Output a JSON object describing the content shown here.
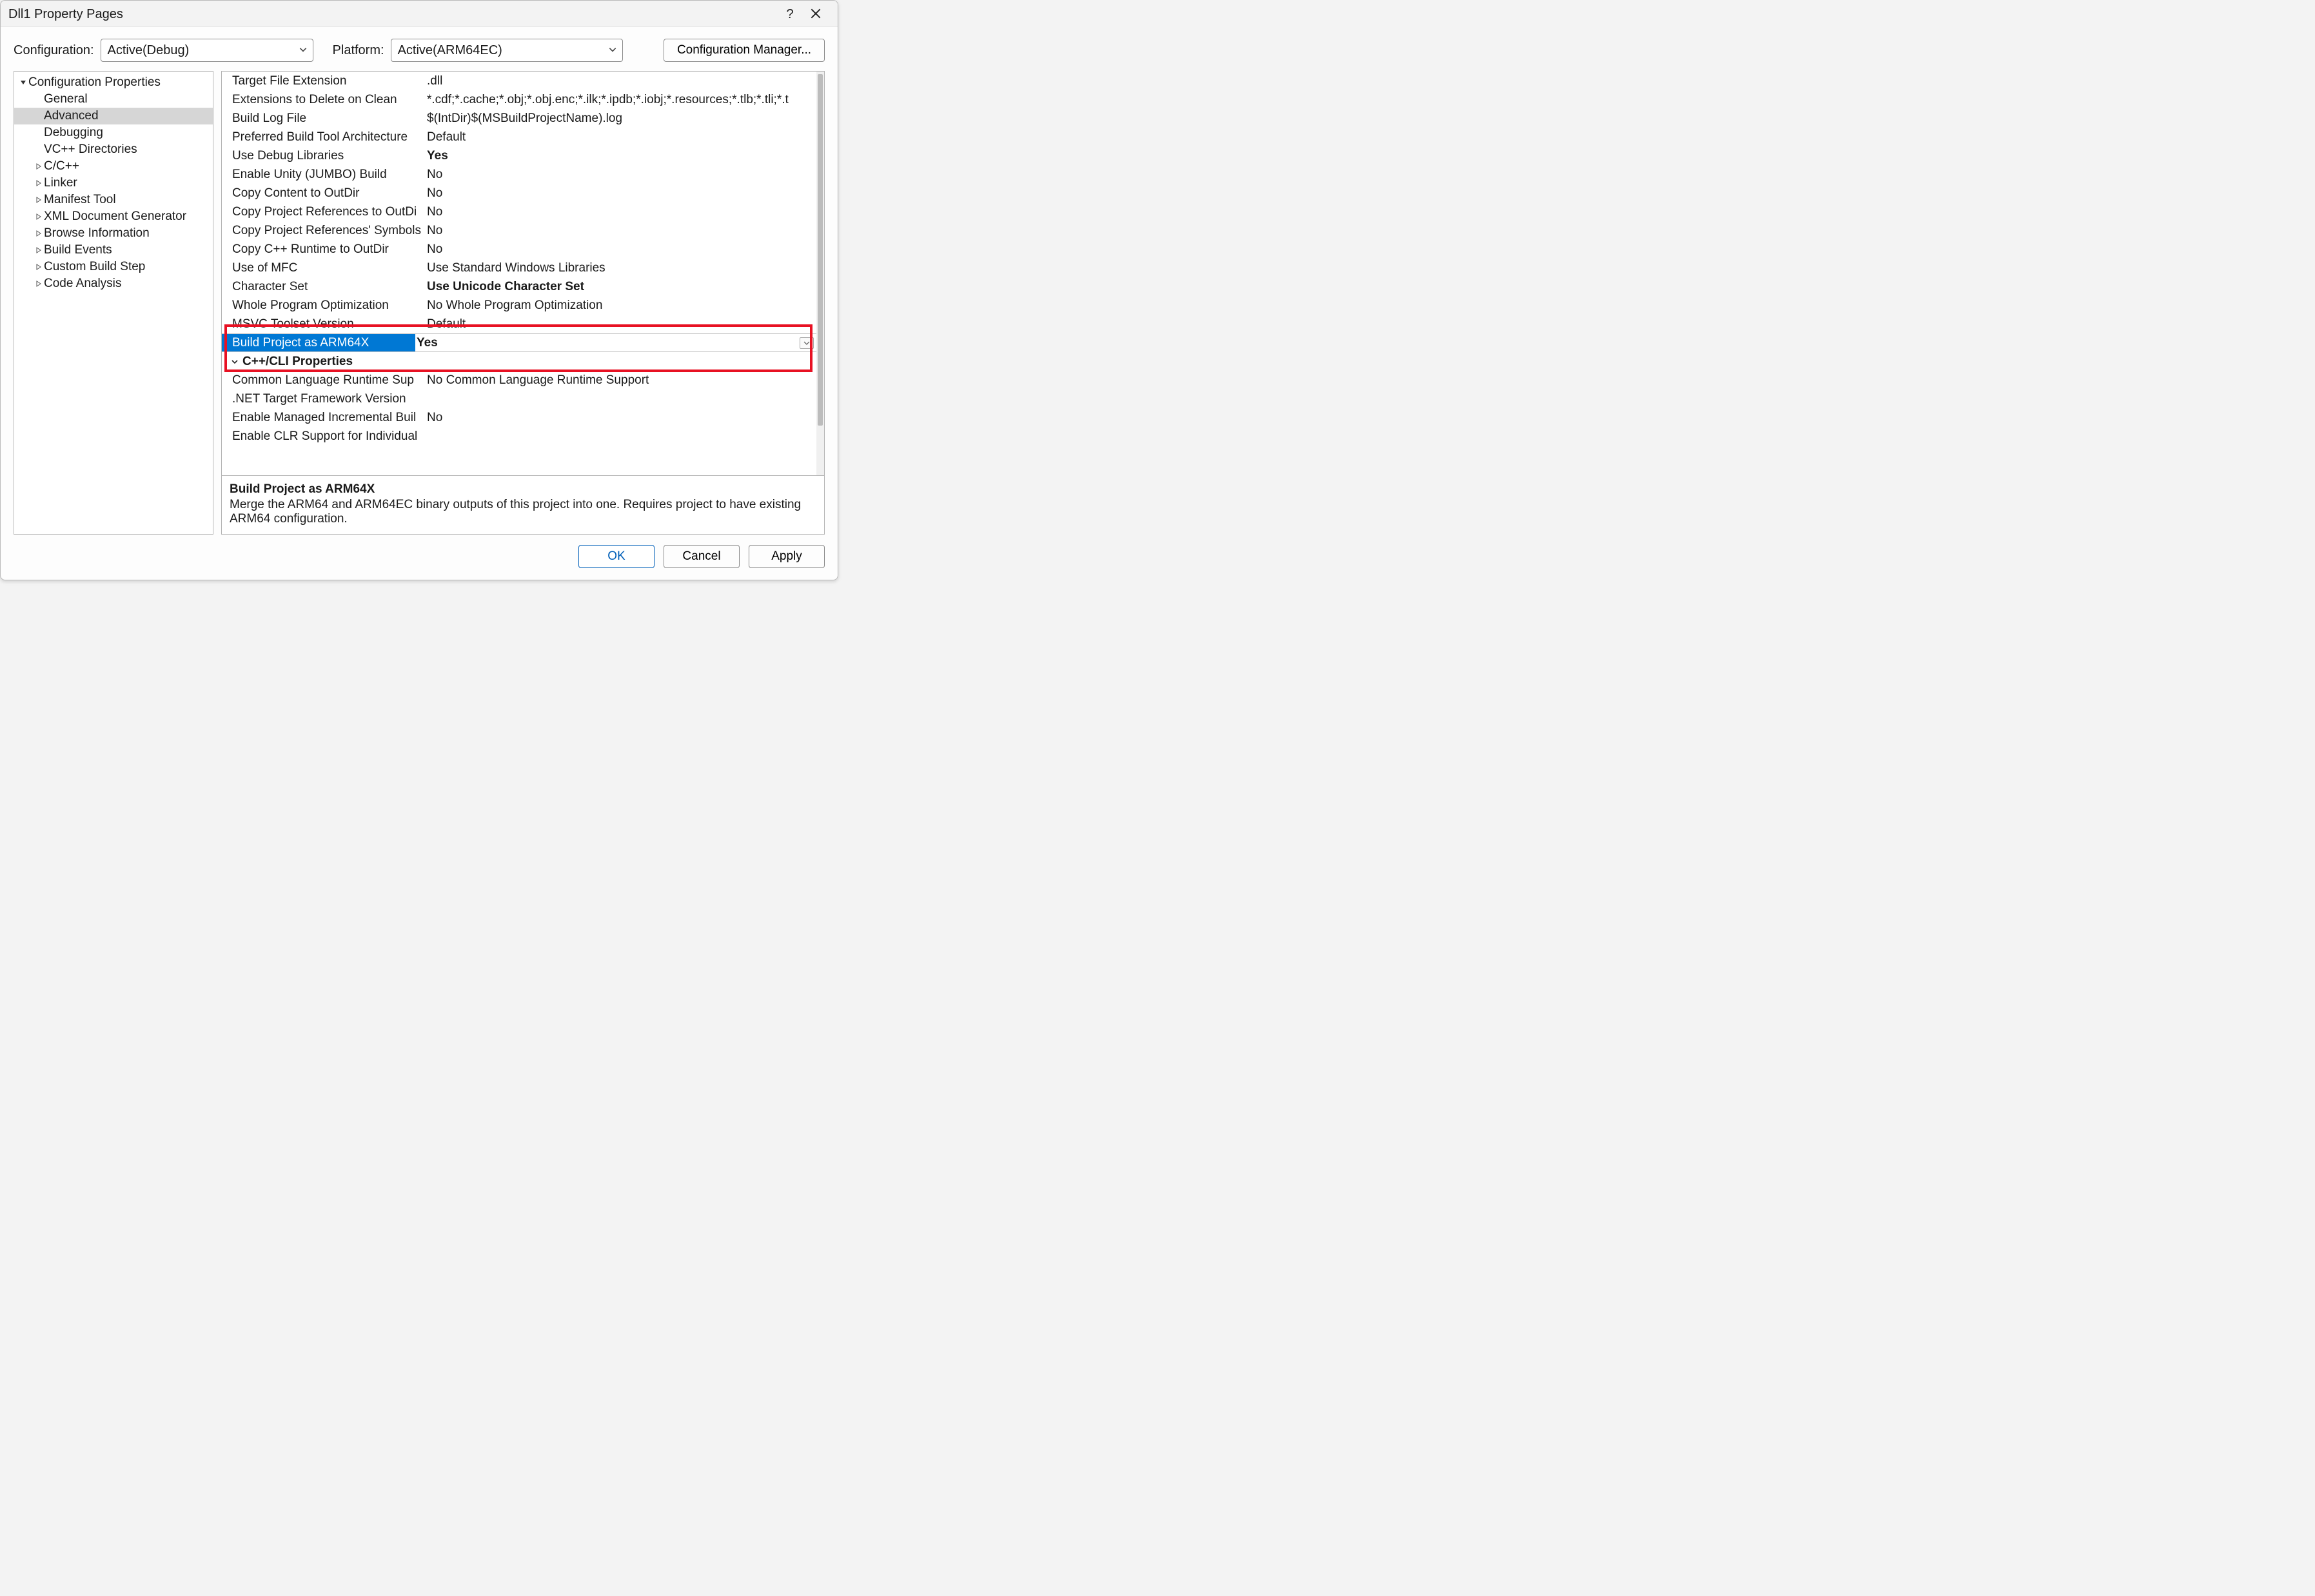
{
  "window": {
    "title": "Dll1 Property Pages"
  },
  "toprow": {
    "config_label": "Configuration:",
    "config_value": "Active(Debug)",
    "platform_label": "Platform:",
    "platform_value": "Active(ARM64EC)",
    "cfgmgr_label": "Configuration Manager..."
  },
  "tree": {
    "root": "Configuration Properties",
    "items": [
      {
        "label": "General",
        "expandable": false
      },
      {
        "label": "Advanced",
        "expandable": false,
        "selected": true
      },
      {
        "label": "Debugging",
        "expandable": false
      },
      {
        "label": "VC++ Directories",
        "expandable": false
      },
      {
        "label": "C/C++",
        "expandable": true
      },
      {
        "label": "Linker",
        "expandable": true
      },
      {
        "label": "Manifest Tool",
        "expandable": true
      },
      {
        "label": "XML Document Generator",
        "expandable": true
      },
      {
        "label": "Browse Information",
        "expandable": true
      },
      {
        "label": "Build Events",
        "expandable": true
      },
      {
        "label": "Custom Build Step",
        "expandable": true
      },
      {
        "label": "Code Analysis",
        "expandable": true
      }
    ]
  },
  "props": [
    {
      "name": "Target File Extension",
      "value": ".dll"
    },
    {
      "name": "Extensions to Delete on Clean",
      "value": "*.cdf;*.cache;*.obj;*.obj.enc;*.ilk;*.ipdb;*.iobj;*.resources;*.tlb;*.tli;*.t"
    },
    {
      "name": "Build Log File",
      "value": "$(IntDir)$(MSBuildProjectName).log"
    },
    {
      "name": "Preferred Build Tool Architecture",
      "value": "Default"
    },
    {
      "name": "Use Debug Libraries",
      "value": "Yes",
      "bold": true
    },
    {
      "name": "Enable Unity (JUMBO) Build",
      "value": "No"
    },
    {
      "name": "Copy Content to OutDir",
      "value": "No"
    },
    {
      "name": "Copy Project References to OutDi",
      "value": "No"
    },
    {
      "name": "Copy Project References' Symbols",
      "value": "No"
    },
    {
      "name": "Copy C++ Runtime to OutDir",
      "value": "No"
    },
    {
      "name": "Use of MFC",
      "value": "Use Standard Windows Libraries"
    },
    {
      "name": "Character Set",
      "value": "Use Unicode Character Set",
      "bold": true
    },
    {
      "name": "Whole Program Optimization",
      "value": "No Whole Program Optimization"
    },
    {
      "name": "MSVC Toolset Version",
      "value": "Default"
    },
    {
      "name": "Build Project as ARM64X",
      "value": "Yes",
      "bold": true,
      "selected": true
    },
    {
      "name": "C++/CLI Properties",
      "group": true
    },
    {
      "name": "Common Language Runtime Sup",
      "value": "No Common Language Runtime Support"
    },
    {
      "name": ".NET Target Framework Version",
      "value": ""
    },
    {
      "name": "Enable Managed Incremental Buil",
      "value": "No"
    },
    {
      "name": "Enable CLR Support for Individual",
      "value": ""
    }
  ],
  "desc": {
    "title": "Build Project as ARM64X",
    "body": "Merge the ARM64 and ARM64EC binary outputs of this project into one. Requires project to have existing ARM64 configuration."
  },
  "footer": {
    "ok": "OK",
    "cancel": "Cancel",
    "apply": "Apply"
  }
}
